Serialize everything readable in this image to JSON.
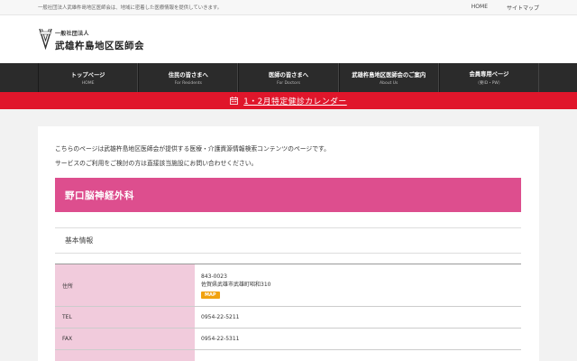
{
  "topbar": {
    "tagline": "一般社団法人武雄杵島地区医師会は、地域に密着した医療情報を提供していきます。",
    "links": [
      "HOME",
      "サイトマップ"
    ]
  },
  "logo": {
    "corp": "一般社団法人",
    "name": "武雄杵島地区医師会"
  },
  "nav": [
    {
      "jp": "トップページ",
      "en": "HOME"
    },
    {
      "jp": "住民の皆さまへ",
      "en": "For Residents"
    },
    {
      "jp": "医師の皆さまへ",
      "en": "For Doctors"
    },
    {
      "jp": "武雄杵島地区医師会のご案内",
      "en": "About Us"
    },
    {
      "jp": "会員専用ページ",
      "en": "（要ID・PW）"
    }
  ],
  "banner": {
    "text": "1・2月特定健診カレンダー",
    "icon": "calendar-icon",
    "color": "#e0162b"
  },
  "intro": {
    "line1": "こちらのページは武雄杵島地区医師会が提供する医療・介護資源情報検索コンテンツのページです。",
    "line2": "サービスのご利用をご検討の方は直接該当施設にお問い合わせください。"
  },
  "clinic": {
    "title": "野口脳神経外科",
    "title_color": "#dd4e8e"
  },
  "section": {
    "heading": "基本情報"
  },
  "table": {
    "address_label": "住所",
    "postal": "843-0023",
    "address": "佐賀県武雄市武雄町昭和310",
    "map_label": "MAP",
    "tel_label": "TEL",
    "tel": "0954-22-5211",
    "fax_label": "FAX",
    "fax": "0954-22-5311"
  }
}
